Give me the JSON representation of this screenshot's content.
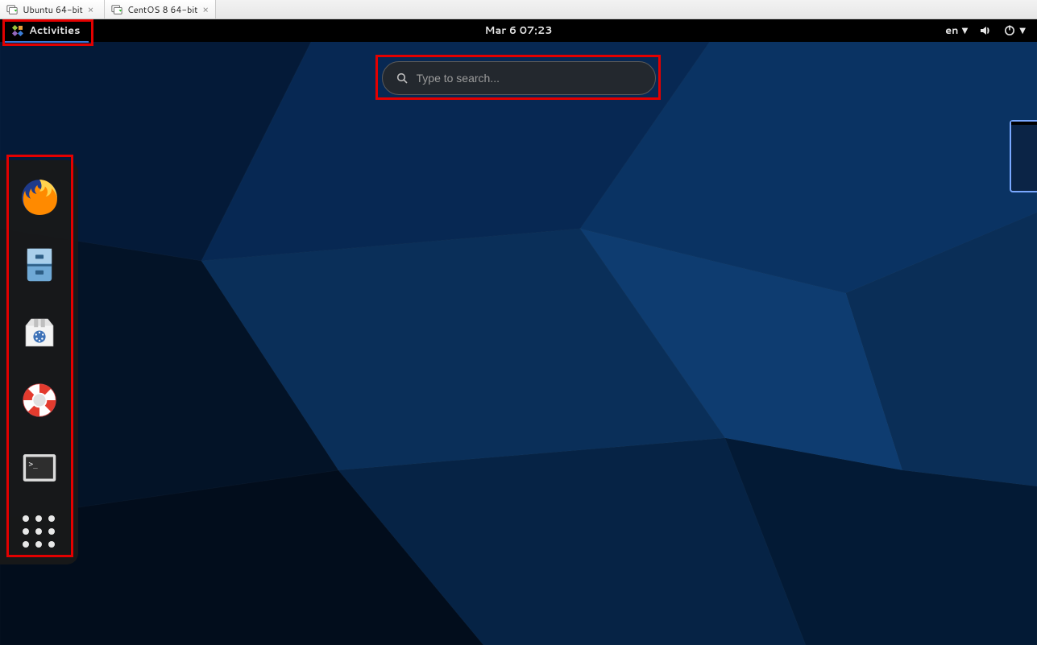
{
  "host": {
    "tabs": [
      {
        "label": "Ubuntu 64-bit",
        "active": false
      },
      {
        "label": "CentOS 8 64-bit",
        "active": true
      }
    ]
  },
  "topbar": {
    "activities_label": "Activities",
    "clock": "Mar 6  07:23",
    "lang": "en"
  },
  "search": {
    "placeholder": "Type to search..."
  },
  "dash": {
    "items": [
      {
        "name": "firefox-icon"
      },
      {
        "name": "files-icon"
      },
      {
        "name": "software-icon"
      },
      {
        "name": "help-icon"
      },
      {
        "name": "terminal-icon"
      },
      {
        "name": "show-apps-icon"
      }
    ]
  }
}
